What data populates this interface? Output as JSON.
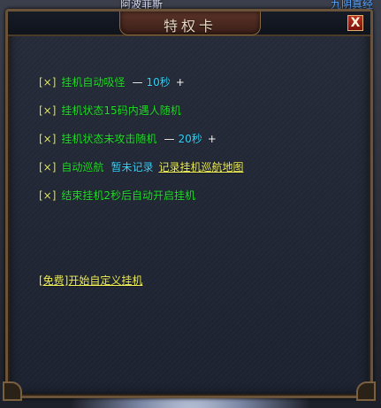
{
  "background": {
    "name_left": "阿波菲斯",
    "name_right": "九阴真经"
  },
  "window": {
    "title": "特权卡",
    "close_label": "X"
  },
  "options": [
    {
      "check": "[×]",
      "label": "挂机自动吸怪",
      "dash": "—",
      "value": "10秒",
      "plus": "+"
    },
    {
      "check": "[×]",
      "label": "挂机状态15码内遇人随机"
    },
    {
      "check": "[×]",
      "label": "挂机状态未攻击随机",
      "dash": "—",
      "value": "20秒",
      "plus": "+"
    },
    {
      "check": "[×]",
      "label": "自动巡航",
      "note": "暂未记录",
      "link": "记录挂机巡航地图"
    },
    {
      "check": "[×]",
      "label": "结束挂机2秒后自动开启挂机"
    }
  ],
  "free_button": "[免费]开始自定义挂机"
}
